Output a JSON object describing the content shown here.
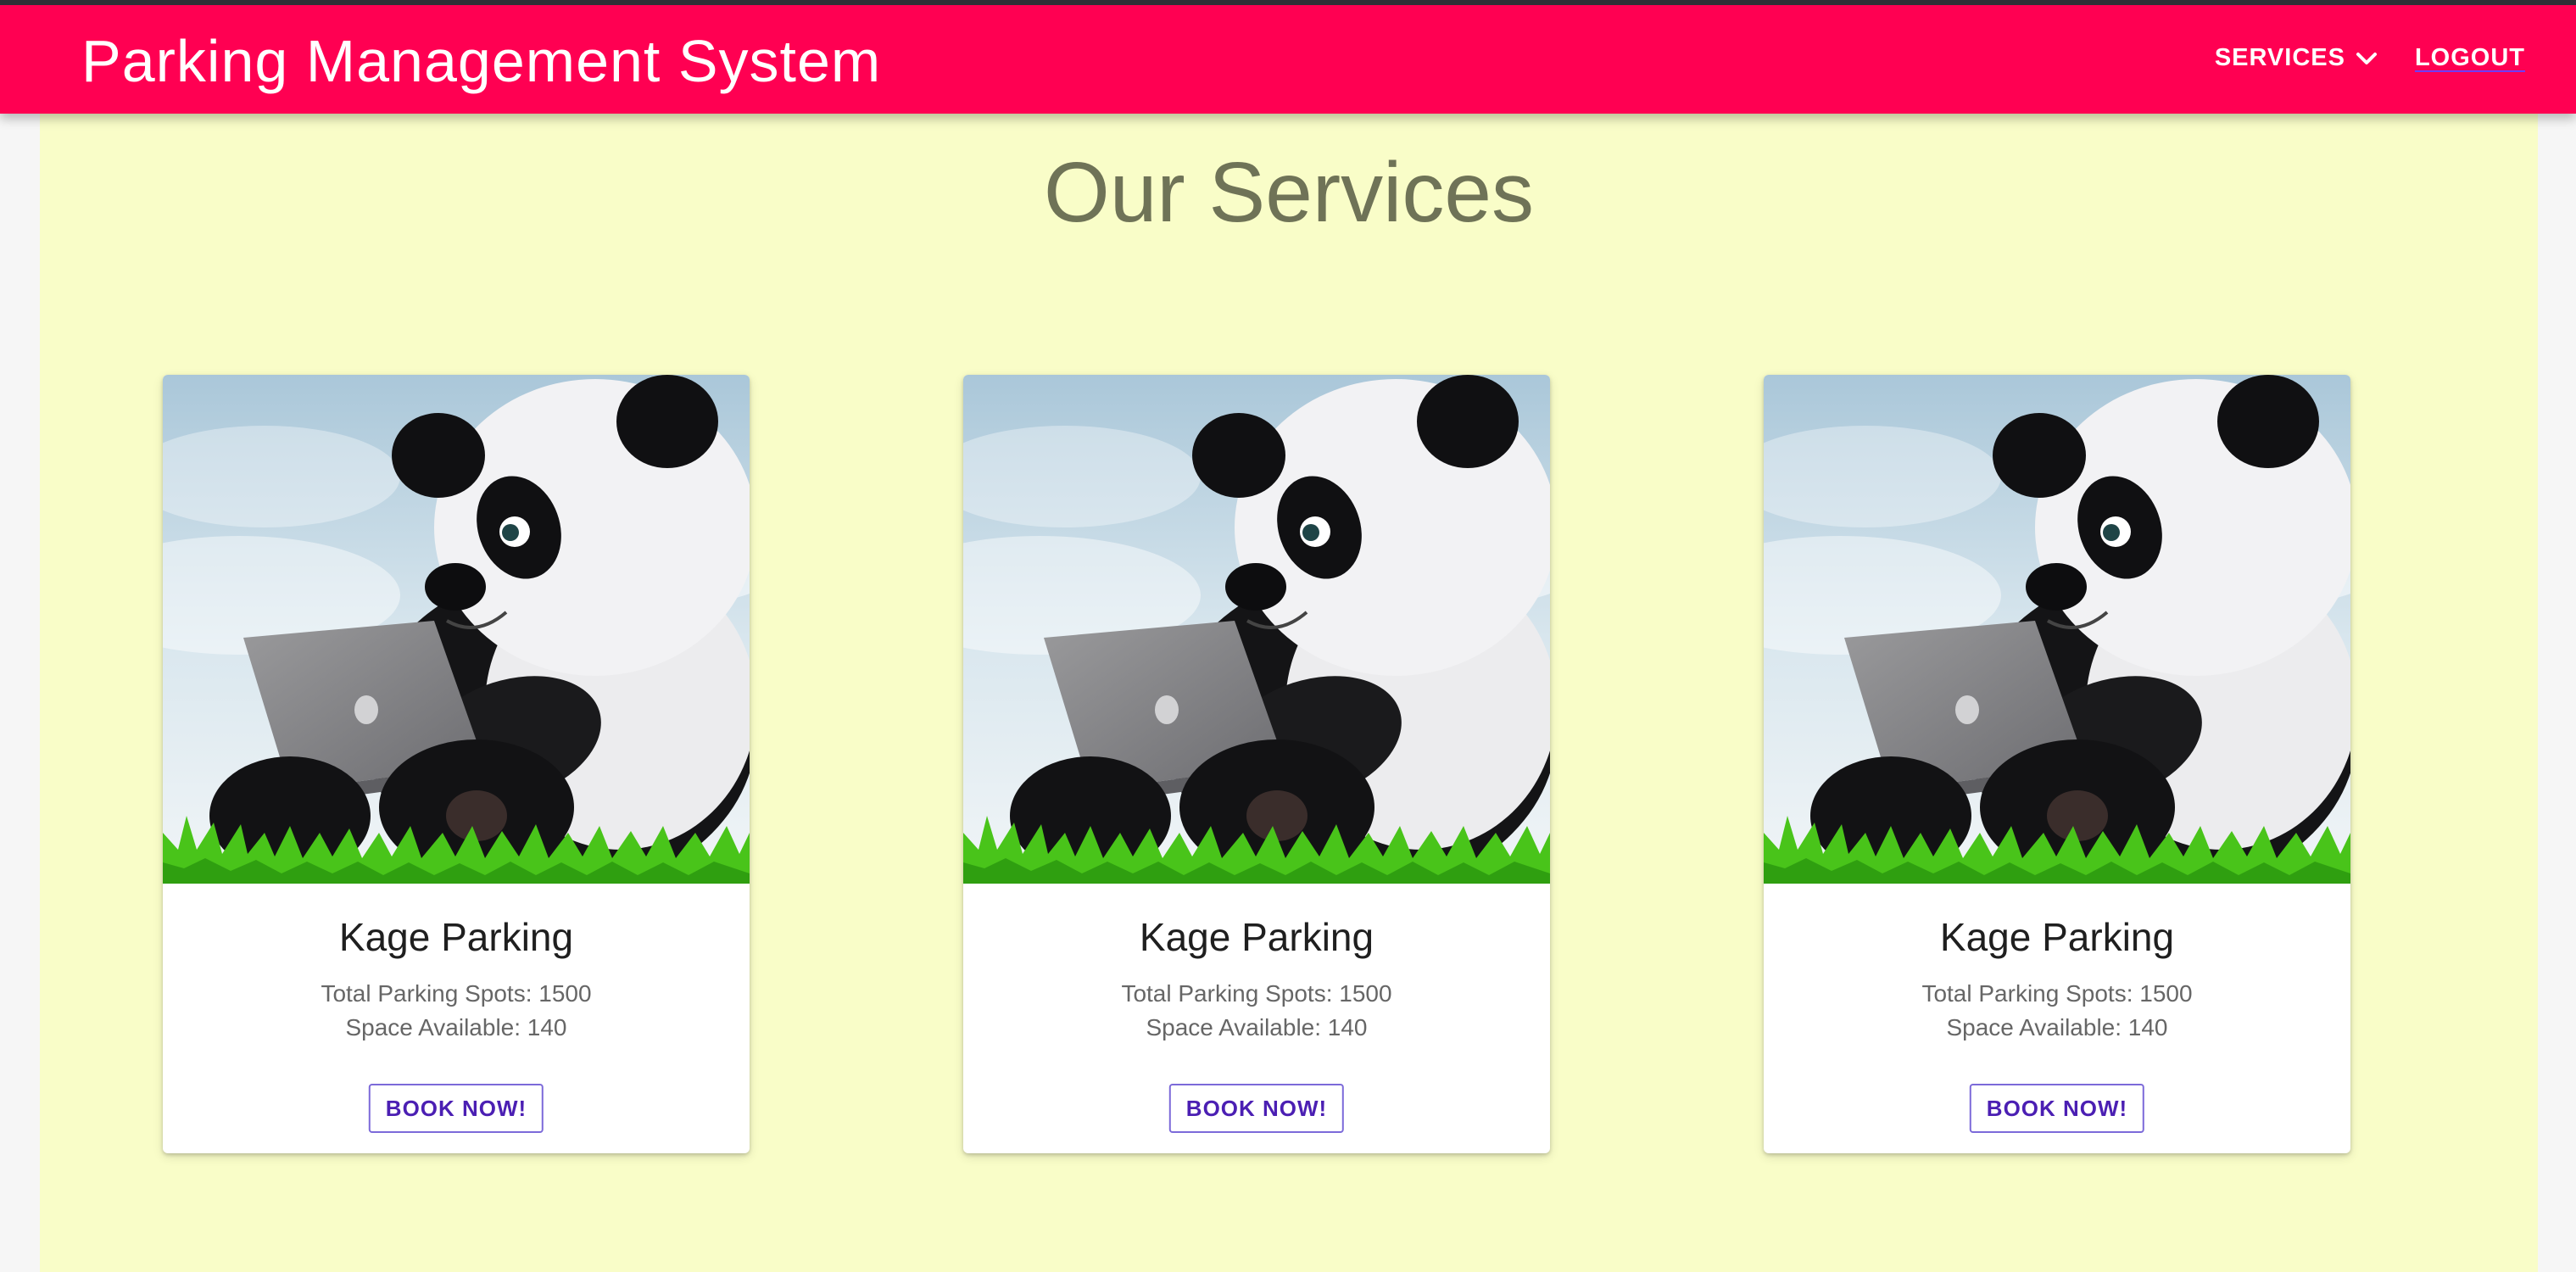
{
  "app": {
    "title": "Parking Management System",
    "brand_color": "#ff0052"
  },
  "nav": {
    "services_label": "SERVICES",
    "services_icon": "chevron-down-icon",
    "logout_label": "LOGOUT"
  },
  "page": {
    "heading": "Our Services",
    "background": "#f9fdc8"
  },
  "cards": [
    {
      "image": "panda-with-laptop",
      "title": "Kage Parking",
      "total_spots": "Total Parking Spots: 1500",
      "space_available": "Space Available: 140",
      "button_label": "BOOK NOW!"
    },
    {
      "image": "panda-with-laptop",
      "title": "Kage Parking",
      "total_spots": "Total Parking Spots: 1500",
      "space_available": "Space Available: 140",
      "button_label": "BOOK NOW!"
    },
    {
      "image": "panda-with-laptop",
      "title": "Kage Parking",
      "total_spots": "Total Parking Spots: 1500",
      "space_available": "Space Available: 140",
      "button_label": "BOOK NOW!"
    }
  ]
}
